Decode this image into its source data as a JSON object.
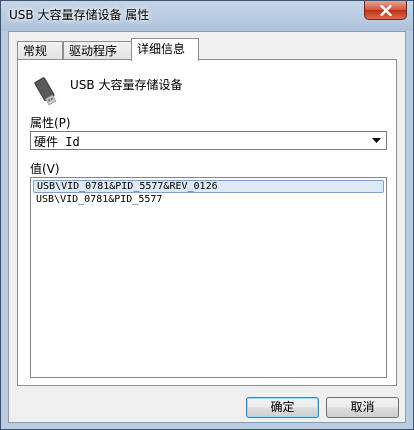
{
  "window": {
    "title": "USB 大容量存储设备 属性"
  },
  "tabs": [
    {
      "label": "常规"
    },
    {
      "label": "驱动程序"
    },
    {
      "label": "详细信息"
    }
  ],
  "device": {
    "name": "USB 大容量存储设备",
    "icon": "usb-drive-icon"
  },
  "property": {
    "label": "属性(P)",
    "selected": "硬件 Id"
  },
  "value": {
    "label": "值(V)",
    "items": [
      "USB\\VID_0781&PID_5577&REV_0126",
      "USB\\VID_0781&PID_5577"
    ]
  },
  "buttons": {
    "ok": "确定",
    "cancel": "取消"
  }
}
